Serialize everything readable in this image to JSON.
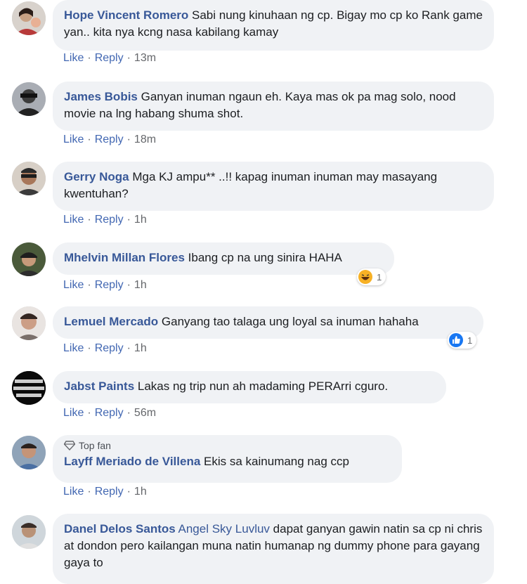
{
  "actions": {
    "like_label": "Like",
    "reply_label": "Reply",
    "separator": "·"
  },
  "colors": {
    "author": "#385898",
    "bubble": "#f0f2f5",
    "action": "#4267b2",
    "meta": "#65676b"
  },
  "comments": [
    {
      "author": "Hope Vincent Romero",
      "text": "Sabi nung kinuhaan ng cp. Bigay mo cp ko Rank game yan.. kita nya kcng nasa kabilang kamay",
      "time": "13m"
    },
    {
      "author": "James Bobis",
      "text": "Ganyan inuman ngaun eh. Kaya mas ok pa mag solo, nood movie na lng habang shuma shot.",
      "time": "18m"
    },
    {
      "author": "Gerry Noga",
      "text": "Mga KJ ampu** ..!! kapag inuman inuman may masayang kwentuhan?",
      "time": "1h"
    },
    {
      "author": "Mhelvin Millan Flores",
      "text": "Ibang cp na ung sinira HAHA",
      "time": "1h",
      "reaction": {
        "icon": "haha-emoji-icon",
        "count": "1"
      }
    },
    {
      "author": "Lemuel Mercado",
      "text": "Ganyang tao talaga ung loyal sa inuman hahaha",
      "time": "1h",
      "reaction": {
        "icon": "like-reaction-icon",
        "count": "1"
      }
    },
    {
      "author": "Jabst Paints",
      "text": "Lakas ng trip nun ah madaming PERArri cguro.",
      "time": "56m"
    },
    {
      "author": "Layff Meriado de Villena",
      "badge": "Top fan",
      "text": "Ekis sa kainumang nag ccp",
      "time": "1h"
    },
    {
      "author": "Danel Delos Santos",
      "mention": "Angel Sky Luvluv",
      "text": "dapat ganyan gawin natin sa cp ni chris at dondon pero kailangan muna natin humanap ng dummy phone para gayang gaya to"
    }
  ]
}
